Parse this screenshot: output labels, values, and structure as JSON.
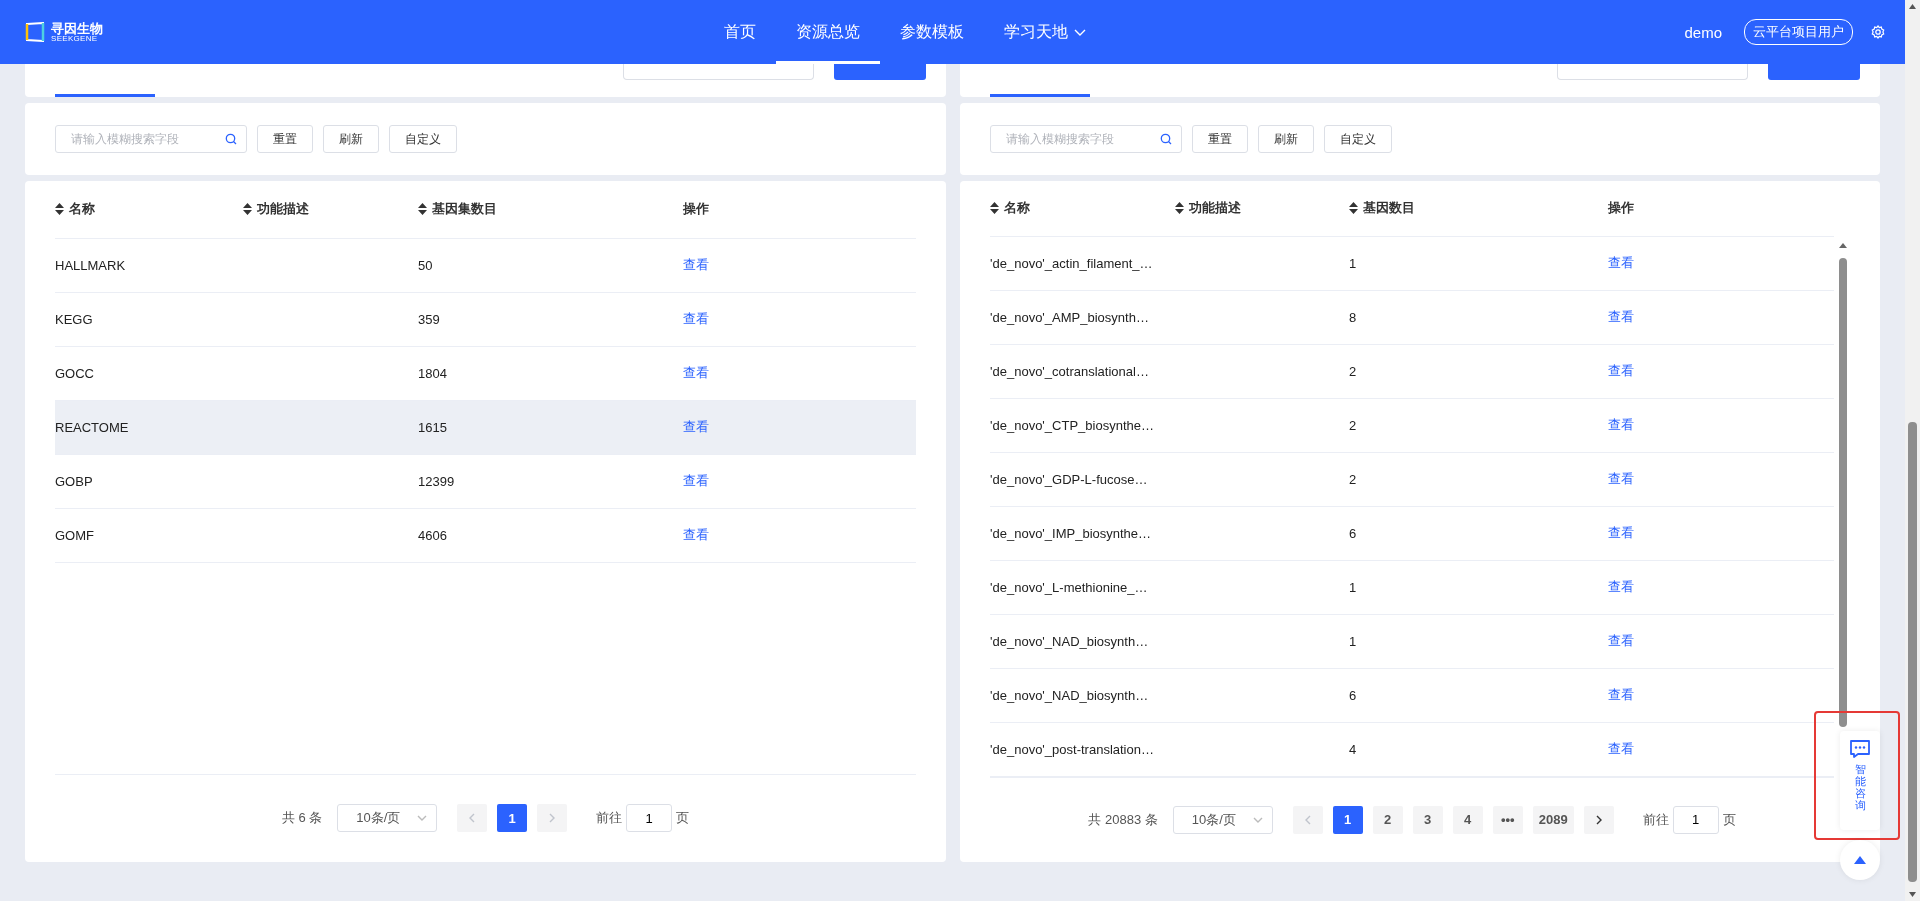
{
  "header": {
    "logo": {
      "name": "寻因生物",
      "subtitle": "SEEKGENE"
    },
    "nav": [
      {
        "label": "首页",
        "selected": false,
        "dropdown": false
      },
      {
        "label": "资源总览",
        "selected": true,
        "dropdown": false
      },
      {
        "label": "参数模板",
        "selected": false,
        "dropdown": false
      },
      {
        "label": "学习天地",
        "selected": false,
        "dropdown": true
      }
    ],
    "user": "demo",
    "role": "云平台项目用户"
  },
  "panels": [
    {
      "tab": {
        "selected": true
      },
      "search_placeholder": "请输入模糊搜索字段",
      "buttons": [
        "重置",
        "刷新",
        "自定义"
      ],
      "columns": [
        {
          "label": "名称",
          "sortable": true
        },
        {
          "label": "功能描述",
          "sortable": true
        },
        {
          "label": "基因集数目",
          "sortable": true
        },
        {
          "label": "操作",
          "sortable": false
        }
      ],
      "rows": [
        {
          "name": "HALLMARK",
          "count": "50",
          "action": "查看",
          "highlighted": false
        },
        {
          "name": "KEGG",
          "count": "359",
          "action": "查看",
          "highlighted": false
        },
        {
          "name": "GOCC",
          "count": "1804",
          "action": "查看",
          "highlighted": false
        },
        {
          "name": "REACTOME",
          "count": "1615",
          "action": "查看",
          "highlighted": true
        },
        {
          "name": "GOBP",
          "count": "12399",
          "action": "查看",
          "highlighted": false
        },
        {
          "name": "GOMF",
          "count": "4606",
          "action": "查看",
          "highlighted": false
        }
      ],
      "pagination": {
        "total": "共 6 条",
        "page_size": "10条/页",
        "prev_disabled": true,
        "next_disabled": true,
        "pages": [
          {
            "label": "1",
            "selected": true,
            "kind": "page"
          }
        ],
        "goto_label": "前往",
        "goto_value": "1",
        "goto_unit": "页"
      }
    },
    {
      "tab": {
        "selected": true
      },
      "search_placeholder": "请输入模糊搜索字段",
      "buttons": [
        "重置",
        "刷新",
        "自定义"
      ],
      "scrollbar": true,
      "columns": [
        {
          "label": "名称",
          "sortable": true
        },
        {
          "label": "功能描述",
          "sortable": true
        },
        {
          "label": "基因数目",
          "sortable": true
        },
        {
          "label": "操作",
          "sortable": false
        }
      ],
      "rows": [
        {
          "name": "'de_novo'_actin_filament_…",
          "count": "1",
          "action": "查看",
          "highlighted": false
        },
        {
          "name": "'de_novo'_AMP_biosynth…",
          "count": "8",
          "action": "查看",
          "highlighted": false
        },
        {
          "name": "'de_novo'_cotranslational…",
          "count": "2",
          "action": "查看",
          "highlighted": false
        },
        {
          "name": "'de_novo'_CTP_biosynthe…",
          "count": "2",
          "action": "查看",
          "highlighted": false
        },
        {
          "name": "'de_novo'_GDP-L-fucose…",
          "count": "2",
          "action": "查看",
          "highlighted": false
        },
        {
          "name": "'de_novo'_IMP_biosynthe…",
          "count": "6",
          "action": "查看",
          "highlighted": false
        },
        {
          "name": "'de_novo'_L-methionine_…",
          "count": "1",
          "action": "查看",
          "highlighted": false
        },
        {
          "name": "'de_novo'_NAD_biosynth…",
          "count": "1",
          "action": "查看",
          "highlighted": false
        },
        {
          "name": "'de_novo'_NAD_biosynth…",
          "count": "6",
          "action": "查看",
          "highlighted": false
        },
        {
          "name": "'de_novo'_post-translation…",
          "count": "4",
          "action": "查看",
          "highlighted": false
        }
      ],
      "pagination": {
        "total": "共 20883 条",
        "page_size": "10条/页",
        "prev_disabled": true,
        "next_disabled": false,
        "pages": [
          {
            "label": "1",
            "selected": true,
            "kind": "page"
          },
          {
            "label": "2",
            "selected": false,
            "kind": "page"
          },
          {
            "label": "3",
            "selected": false,
            "kind": "page"
          },
          {
            "label": "4",
            "selected": false,
            "kind": "page"
          },
          {
            "label": "•••",
            "kind": "ellipsis"
          },
          {
            "label": "2089",
            "selected": false,
            "kind": "page"
          }
        ],
        "goto_label": "前往",
        "goto_value": "1",
        "goto_unit": "页"
      }
    }
  ],
  "chat_widget": {
    "label": "智能咨询",
    "highlight_frame": true
  }
}
